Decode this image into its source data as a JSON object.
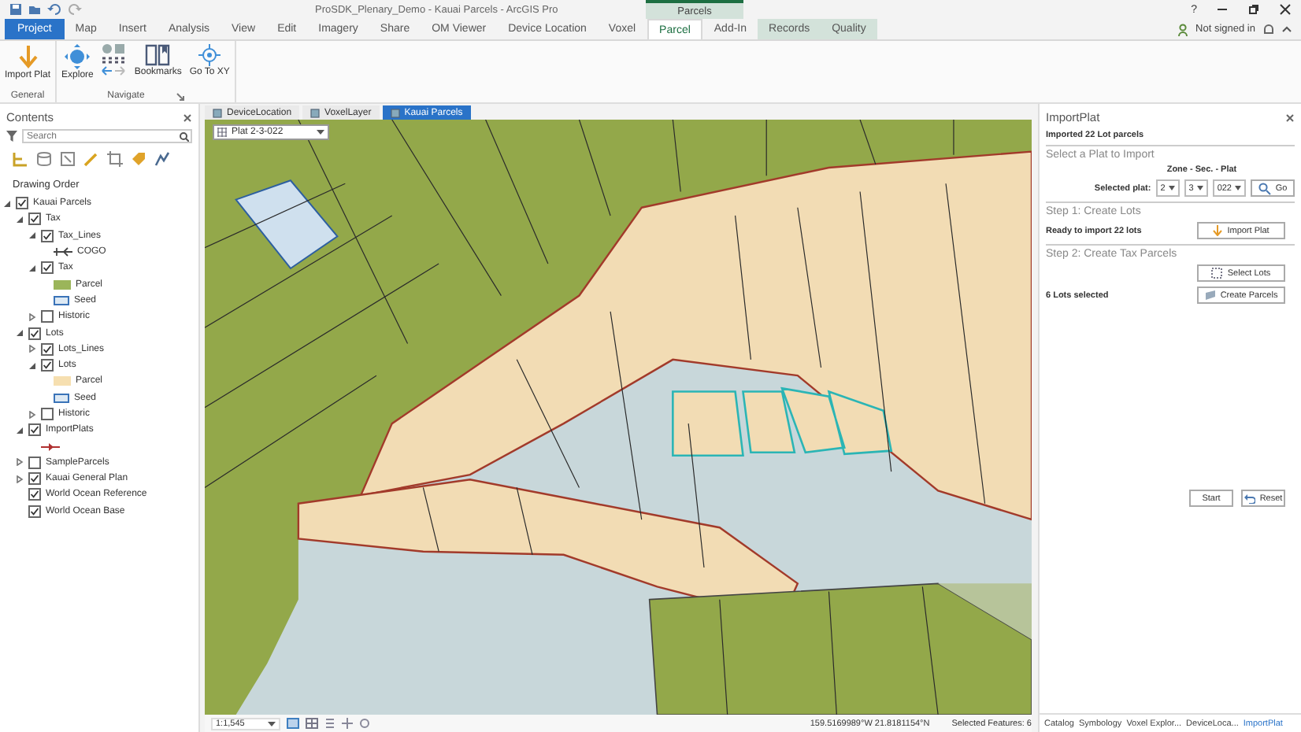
{
  "window": {
    "title": "ProSDK_Plenary_Demo - Kauai Parcels - ArcGIS Pro",
    "contextual_label": "Parcels",
    "help": "?"
  },
  "ribbon_tabs": [
    {
      "label": "Project",
      "selected": false,
      "kind": "backstage"
    },
    {
      "label": "Map",
      "selected": false,
      "kind": "tab"
    },
    {
      "label": "Insert",
      "selected": false,
      "kind": "tab"
    },
    {
      "label": "Analysis",
      "selected": false,
      "kind": "tab"
    },
    {
      "label": "View",
      "selected": false,
      "kind": "tab"
    },
    {
      "label": "Edit",
      "selected": false,
      "kind": "tab"
    },
    {
      "label": "Imagery",
      "selected": false,
      "kind": "tab"
    },
    {
      "label": "Share",
      "selected": false,
      "kind": "tab"
    },
    {
      "label": "OM Viewer",
      "selected": false,
      "kind": "tab"
    },
    {
      "label": "Device Location",
      "selected": false,
      "kind": "tab"
    },
    {
      "label": "Voxel",
      "selected": false,
      "kind": "tab"
    },
    {
      "label": "Parcel",
      "selected": true,
      "kind": "tab"
    },
    {
      "label": "Add-In",
      "selected": false,
      "kind": "tab"
    },
    {
      "label": "Records",
      "selected": false,
      "kind": "contextual"
    },
    {
      "label": "Quality",
      "selected": false,
      "kind": "contextual"
    }
  ],
  "account": "Not signed in",
  "ribbon_groups": [
    {
      "label": "General",
      "buttons": [
        {
          "kind": "large",
          "label": "Import Plat"
        }
      ]
    },
    {
      "label": "Navigate",
      "buttons": [
        {
          "kind": "large",
          "label": "Explore"
        },
        {
          "kind": "small-set"
        },
        {
          "kind": "large",
          "label": "Bookmarks"
        },
        {
          "kind": "large",
          "label": "Go To XY"
        }
      ]
    }
  ],
  "contents": {
    "title": "Contents",
    "search_placeholder": "Search",
    "heading": "Drawing Order",
    "layers": [
      {
        "kind": "layer",
        "label": "Kauai Parcels",
        "checked": true,
        "expanded": true,
        "children": [
          {
            "kind": "layer",
            "label": "Tax",
            "checked": true,
            "expanded": true,
            "children": [
              {
                "kind": "layer",
                "label": "Tax_Lines",
                "checked": true,
                "expanded": true,
                "children": [
                  {
                    "kind": "line",
                    "label": "COGO"
                  }
                ]
              },
              {
                "kind": "layer",
                "label": "Tax",
                "checked": true,
                "expanded": true,
                "children": [
                  {
                    "kind": "fill",
                    "label": "Parcel",
                    "color": "#9bb55a"
                  },
                  {
                    "kind": "outlined-fill",
                    "label": "Seed",
                    "color": "#dde9f4"
                  }
                ]
              },
              {
                "kind": "layer",
                "label": "Historic",
                "checked": false,
                "expanded": false
              }
            ]
          },
          {
            "kind": "layer",
            "label": "Lots",
            "checked": true,
            "expanded": true,
            "children": [
              {
                "kind": "layer",
                "label": "Lots_Lines",
                "checked": true,
                "expanded": false
              },
              {
                "kind": "layer",
                "label": "Lots",
                "checked": true,
                "expanded": true,
                "children": [
                  {
                    "kind": "fill",
                    "label": "Parcel",
                    "color": "#f6dfb0"
                  },
                  {
                    "kind": "outlined-fill",
                    "label": "Seed",
                    "color": "#dde9f4"
                  }
                ]
              },
              {
                "kind": "layer",
                "label": "Historic",
                "checked": false,
                "expanded": false
              }
            ]
          },
          {
            "kind": "layer",
            "label": "ImportPlats",
            "checked": true,
            "expanded": true,
            "children": [
              {
                "kind": "arrow"
              }
            ]
          },
          {
            "kind": "layer",
            "label": "SampleParcels",
            "checked": false,
            "expanded": false
          },
          {
            "kind": "layer",
            "label": "Kauai General Plan",
            "checked": true,
            "expanded": false
          },
          {
            "kind": "layer",
            "label": "World Ocean Reference",
            "checked": true
          },
          {
            "kind": "layer",
            "label": "World Ocean Base",
            "checked": true
          }
        ]
      }
    ]
  },
  "map_tabs": [
    {
      "label": "DeviceLocation",
      "selected": false
    },
    {
      "label": "VoxelLayer",
      "selected": false
    },
    {
      "label": "Kauai Parcels",
      "selected": true
    }
  ],
  "map": {
    "plat_combo": "Plat 2-3-022",
    "scale": "1:1,545",
    "coordinates": "159.5169989°W 21.8181154°N",
    "selected_features": "Selected Features: 6"
  },
  "import_plat": {
    "title": "ImportPlat",
    "status": "Imported 22 Lot parcels",
    "section_select": "Select a Plat to Import",
    "zone_label": "Zone - Sec. - Plat",
    "selected_plat_label": "Selected plat:",
    "plat_values": [
      "2",
      "3",
      "022"
    ],
    "go": "Go",
    "step1": "Step 1: Create Lots",
    "ready": "Ready to import 22 lots",
    "import_button": "Import Plat",
    "step2": "Step 2: Create Tax Parcels",
    "select_lots": "Select Lots",
    "lots_selected": "6 Lots selected",
    "create_parcels": "Create Parcels",
    "start": "Start",
    "reset": "Reset"
  },
  "pane_tabs": [
    {
      "label": "Catalog",
      "selected": false
    },
    {
      "label": "Symbology",
      "selected": false
    },
    {
      "label": "Voxel Explor...",
      "selected": false
    },
    {
      "label": "DeviceLoca...",
      "selected": false
    },
    {
      "label": "ImportPlat",
      "selected": true
    }
  ]
}
